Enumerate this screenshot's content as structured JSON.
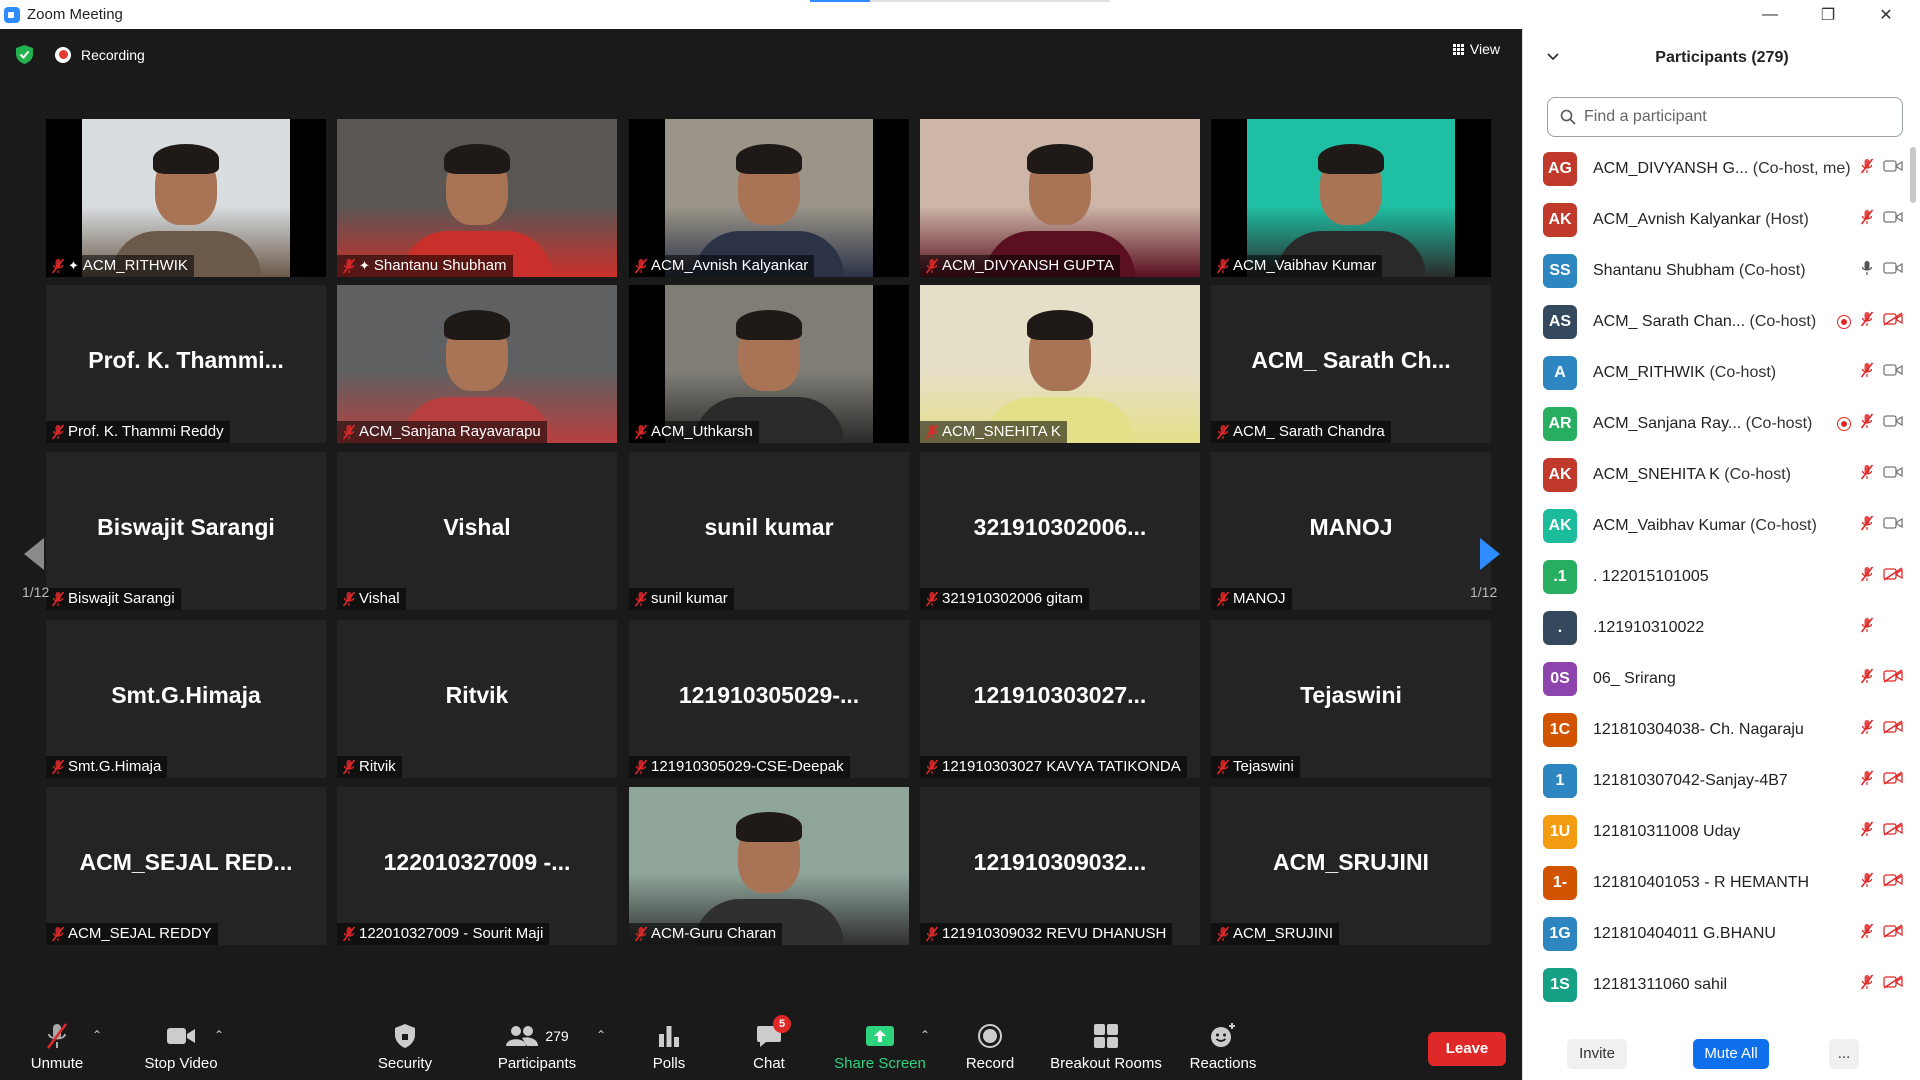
{
  "window": {
    "title": "Zoom Meeting",
    "minimize": "—",
    "maximize": "❐",
    "close": "✕"
  },
  "status": {
    "recording_label": "Recording",
    "view_label": "View"
  },
  "tiles": [
    {
      "name": "ACM_RITHWIK",
      "big": "",
      "video": true,
      "pinned": true
    },
    {
      "name": "Shantanu Shubham",
      "big": "",
      "video": true,
      "active": true,
      "pinned": true
    },
    {
      "name": "ACM_Avnish Kalyankar",
      "big": "",
      "video": true
    },
    {
      "name": "ACM_DIVYANSH GUPTA",
      "big": "",
      "video": true
    },
    {
      "name": "ACM_Vaibhav Kumar",
      "big": "",
      "video": true
    },
    {
      "name": "Prof. K. Thammi Reddy",
      "big": "Prof.  K.  Thammi..."
    },
    {
      "name": "ACM_Sanjana Rayavarapu",
      "big": "",
      "video": true
    },
    {
      "name": "ACM_Uthkarsh",
      "big": "",
      "video": true
    },
    {
      "name": "ACM_SNEHITA K",
      "big": "",
      "video": true
    },
    {
      "name": "ACM_ Sarath Chandra",
      "big": "ACM_  Sarath  Ch..."
    },
    {
      "name": "Biswajit Sarangi",
      "big": "Biswajit Sarangi"
    },
    {
      "name": "Vishal",
      "big": "Vishal"
    },
    {
      "name": "sunil kumar",
      "big": "sunil kumar"
    },
    {
      "name": "321910302006 gitam",
      "big": "321910302006..."
    },
    {
      "name": "MANOJ",
      "big": "MANOJ"
    },
    {
      "name": "Smt.G.Himaja",
      "big": "Smt.G.Himaja"
    },
    {
      "name": "Ritvik",
      "big": "Ritvik"
    },
    {
      "name": "121910305029-CSE-Deepak",
      "big": "121910305029-..."
    },
    {
      "name": "121910303027 KAVYA TATIKONDA",
      "big": "121910303027..."
    },
    {
      "name": "Tejaswini",
      "big": "Tejaswini"
    },
    {
      "name": "ACM_SEJAL REDDY",
      "big": "ACM_SEJAL  RED..."
    },
    {
      "name": "122010327009 - Sourit Maji",
      "big": "122010327009  -..."
    },
    {
      "name": "ACM-Guru Charan",
      "big": "",
      "video": true
    },
    {
      "name": "121910309032 REVU DHANUSH",
      "big": "121910309032..."
    },
    {
      "name": "ACM_SRUJINI",
      "big": "ACM_SRUJINI"
    }
  ],
  "pagination": {
    "left": "1/12",
    "right": "1/12"
  },
  "toolbar": {
    "unmute": "Unmute",
    "stop_video": "Stop Video",
    "security": "Security",
    "participants": "Participants",
    "participants_count": "279",
    "polls": "Polls",
    "chat": "Chat",
    "chat_badge": "5",
    "share_screen": "Share Screen",
    "record": "Record",
    "breakout_rooms": "Breakout Rooms",
    "reactions": "Reactions",
    "leave": "Leave"
  },
  "panel": {
    "title": "Participants (279)",
    "search_placeholder": "Find a participant",
    "invite": "Invite",
    "mute_all": "Mute All",
    "more": "...",
    "participants": [
      {
        "initials": "AG",
        "color": "#c0392b",
        "name": "ACM_DIVYANSH G...",
        "role": " (Co-host, me)",
        "mic": "off",
        "video": "on",
        "rec": false
      },
      {
        "initials": "AK",
        "color": "#c0392b",
        "name": "ACM_Avnish Kalyankar",
        "role": " (Host)",
        "mic": "off",
        "video": "on",
        "rec": false
      },
      {
        "initials": "SS",
        "color": "#2e86c1",
        "name": "Shantanu Shubham",
        "role": " (Co-host)",
        "mic": "on",
        "video": "on",
        "rec": false
      },
      {
        "initials": "AS",
        "color": "#34495e",
        "name": "ACM_ Sarath Chan...",
        "role": " (Co-host)",
        "mic": "off",
        "video": "off",
        "rec": true
      },
      {
        "initials": "A",
        "color": "#2e86c1",
        "name": "ACM_RITHWIK",
        "role": " (Co-host)",
        "mic": "off",
        "video": "on",
        "rec": false
      },
      {
        "initials": "AR",
        "color": "#27ae60",
        "name": "ACM_Sanjana Ray...",
        "role": " (Co-host)",
        "mic": "off",
        "video": "on",
        "rec": true
      },
      {
        "initials": "AK",
        "color": "#c0392b",
        "name": "ACM_SNEHITA K",
        "role": " (Co-host)",
        "mic": "off",
        "video": "on",
        "rec": false
      },
      {
        "initials": "AK",
        "color": "#1abc9c",
        "name": "ACM_Vaibhav Kumar",
        "role": " (Co-host)",
        "mic": "off",
        "video": "on",
        "rec": false
      },
      {
        "initials": ".1",
        "color": "#27ae60",
        "name": ". 122015101005",
        "role": "",
        "mic": "off",
        "video": "off",
        "rec": false
      },
      {
        "initials": ".",
        "color": "#34495e",
        "name": ".121910310022",
        "role": "",
        "mic": "off",
        "video": "none",
        "rec": false
      },
      {
        "initials": "0S",
        "color": "#8e44ad",
        "name": "06_ Srirang",
        "role": "",
        "mic": "off",
        "video": "off",
        "rec": false
      },
      {
        "initials": "1C",
        "color": "#d35400",
        "name": "121810304038- Ch. Nagaraju",
        "role": "",
        "mic": "off",
        "video": "off",
        "rec": false
      },
      {
        "initials": "1",
        "color": "#2e86c1",
        "name": "121810307042-Sanjay-4B7",
        "role": "",
        "mic": "off",
        "video": "off",
        "rec": false
      },
      {
        "initials": "1U",
        "color": "#f39c12",
        "name": "121810311008 Uday",
        "role": "",
        "mic": "off",
        "video": "off",
        "rec": false
      },
      {
        "initials": "1-",
        "color": "#d35400",
        "name": "121810401053 - R HEMANTH",
        "role": "",
        "mic": "off",
        "video": "off",
        "rec": false
      },
      {
        "initials": "1G",
        "color": "#2e86c1",
        "name": "121810404011 G.BHANU",
        "role": "",
        "mic": "off",
        "video": "off",
        "rec": false
      },
      {
        "initials": "1S",
        "color": "#16a085",
        "name": "12181311060 sahil",
        "role": "",
        "mic": "off",
        "video": "off",
        "rec": false
      }
    ]
  }
}
